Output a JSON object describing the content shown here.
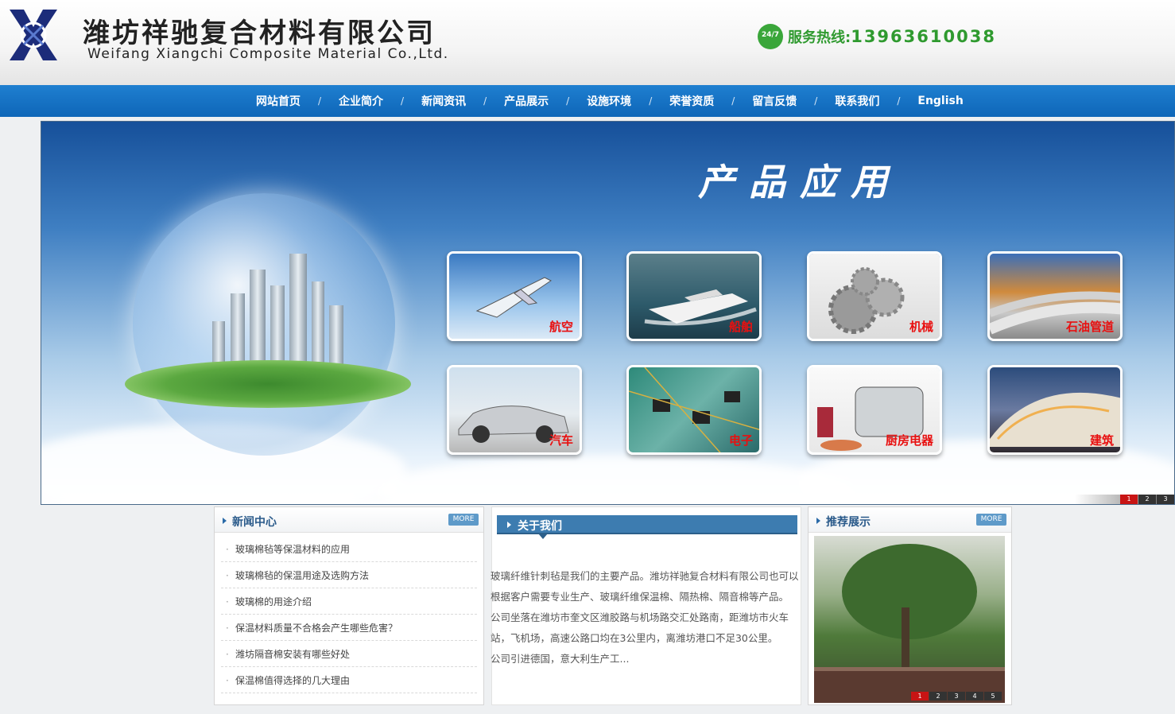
{
  "header": {
    "company_cn": "潍坊祥驰复合材料有限公司",
    "company_en": "Weifang Xiangchi Composite Material Co.,Ltd.",
    "hotline_badge": "24/7",
    "hotline_label": "服务热线:",
    "hotline_number": "13963610038"
  },
  "nav": {
    "items": [
      "网站首页",
      "企业简介",
      "新闻资讯",
      "产品展示",
      "设施环境",
      "荣誉资质",
      "留言反馈",
      "联系我们",
      "English"
    ],
    "separator": "/"
  },
  "banner": {
    "title": "产品应用",
    "applications": [
      "航空",
      "船舶",
      "机械",
      "石油管道",
      "汽车",
      "电子",
      "厨房电器",
      "建筑"
    ],
    "slides": [
      "1",
      "2",
      "3"
    ],
    "active_slide": "1"
  },
  "news": {
    "title": "新闻中心",
    "more": "MORE",
    "items": [
      "玻璃棉毡等保温材料的应用",
      "玻璃棉毡的保温用途及选购方法",
      "玻璃棉的用途介绍",
      "保温材料质量不合格会产生哪些危害？",
      "潍坊隔音棉安装有哪些好处",
      "保温棉值得选择的几大理由"
    ]
  },
  "about": {
    "title": "关于我们",
    "paragraphs": [
      "玻璃纤维针刺毡是我们的主要产品。潍坊祥驰复合材料有限公司也可以根据客户需要专业生产、玻璃纤维保温棉、隔热棉、隔音棉等产品。",
      "公司坐落在潍坊市奎文区潍胶路与机场路交汇处路南，距潍坊市火车站，飞机场，高速公路口均在3公里内，离潍坊港口不足30公里。",
      "公司引进德国，意大利生产工..."
    ]
  },
  "recommend": {
    "title": "推荐展示",
    "more": "MORE",
    "slides": [
      "1",
      "2",
      "3",
      "4",
      "5"
    ],
    "active_slide": "1"
  },
  "colors": {
    "nav_blue": "#0e66b8",
    "hotline_green": "#2f9a2f",
    "caption_red": "#e81010",
    "panel_title_blue": "#2a5a8a"
  }
}
